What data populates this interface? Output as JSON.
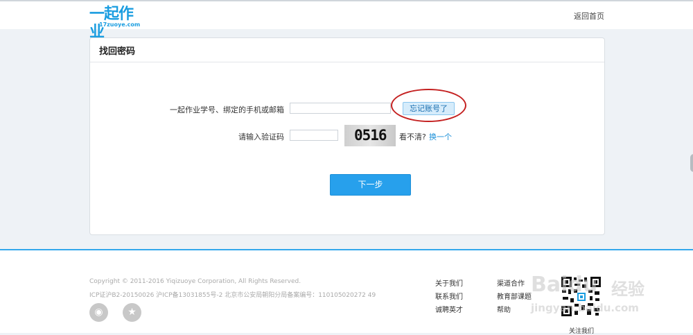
{
  "header": {
    "logo_text": "一起作业",
    "logo_sub": "17zuoye.com",
    "home_link": "返回首页"
  },
  "panel": {
    "title": "找回密码",
    "account_label": "一起作业学号、绑定的手机或邮箱",
    "account_value": "",
    "forgot_button": "忘记账号了",
    "captcha_label": "请输入验证码",
    "captcha_value": "",
    "captcha_image_text": "0516",
    "unclear_text": "看不清?",
    "change_link": "换一个",
    "next_button": "下一步"
  },
  "footer": {
    "copyright": "Copyright © 2011-2016 Yiqizuoye Corporation, All Rights Reserved.",
    "icp": "ICP证沪B2-20150026 沪ICP备13031855号-2 北京市公安局朝阳分局备案编号：110105020272 49",
    "links_col1": [
      "关于我们",
      "联系我们",
      "诚聘英才"
    ],
    "links_col2": [
      "渠道合作",
      "教育部课题",
      "帮助"
    ],
    "follow_label": "关注我们",
    "watermark_brand": "Baidu",
    "watermark_cn": "经验",
    "watermark_url": "jingyan.baidu.com"
  },
  "colors": {
    "accent": "#27a0ec",
    "highlight_ring": "#c42020",
    "link": "#1a8fd8"
  }
}
